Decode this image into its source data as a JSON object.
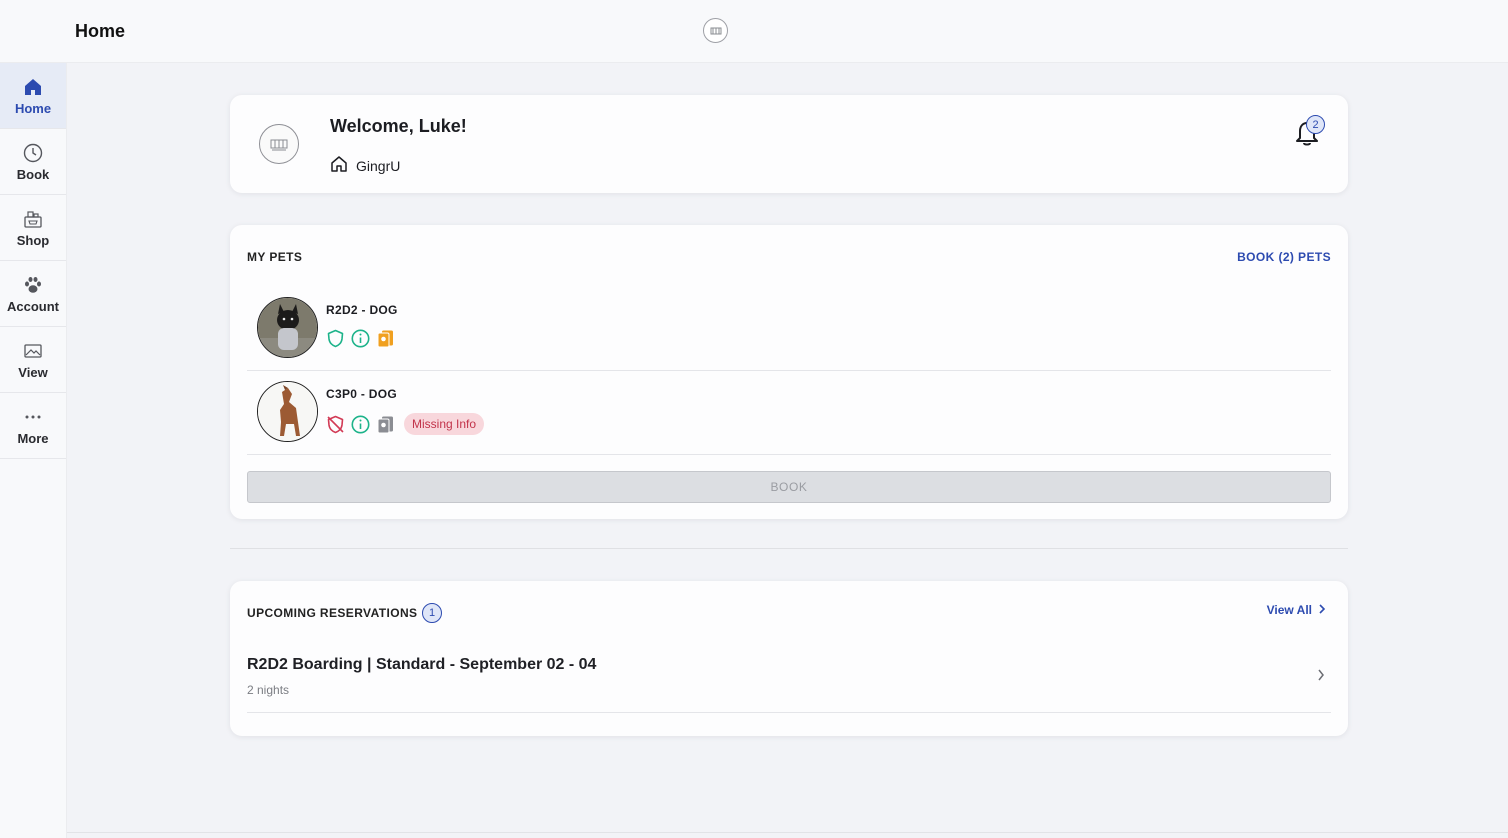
{
  "header": {
    "title": "Home"
  },
  "sidebar": {
    "items": [
      {
        "label": "Home",
        "icon": "home-icon",
        "active": true
      },
      {
        "label": "Book",
        "icon": "clock-icon",
        "active": false
      },
      {
        "label": "Shop",
        "icon": "shop-icon",
        "active": false
      },
      {
        "label": "Account",
        "icon": "paw-icon",
        "active": false
      },
      {
        "label": "View",
        "icon": "image-icon",
        "active": false
      },
      {
        "label": "More",
        "icon": "more-dots-icon",
        "active": false
      }
    ]
  },
  "welcome": {
    "greeting": "Welcome, Luke!",
    "location": "GingrU",
    "notification_count": "2"
  },
  "pets": {
    "title": "MY PETS",
    "book_link": "BOOK (2) PETS",
    "items": [
      {
        "name": "R2D2 - DOG",
        "icons": [
          "shield-check-icon",
          "info-icon",
          "document-icon"
        ],
        "badge": ""
      },
      {
        "name": "C3P0 - DOG",
        "icons": [
          "shield-off-icon",
          "info-icon",
          "document-icon"
        ],
        "badge": "Missing Info"
      }
    ],
    "book_button": "BOOK"
  },
  "reservations": {
    "title": "UPCOMING RESERVATIONS",
    "count": "1",
    "view_all": "View All",
    "items": [
      {
        "title": "R2D2 Boarding | Standard - September 02 - 04",
        "subtitle": "2 nights"
      }
    ]
  },
  "colors": {
    "accent": "#2d4bb0",
    "success": "#1db38a",
    "warning": "#f0a020",
    "danger": "#d23a55",
    "badge_bg": "#f8d7dc"
  }
}
